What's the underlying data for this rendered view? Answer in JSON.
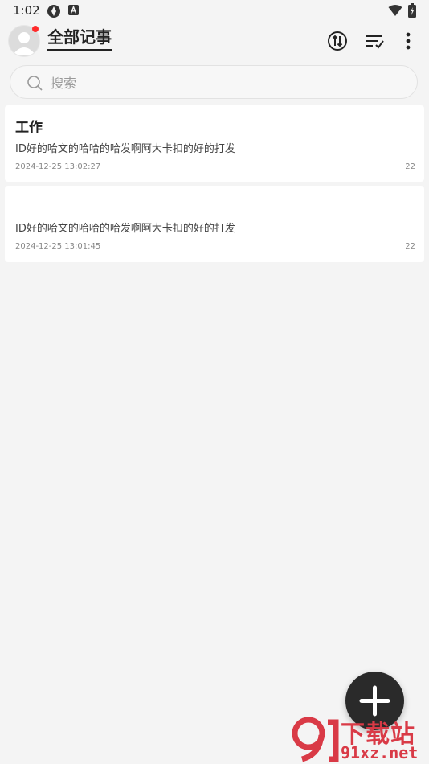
{
  "status_bar": {
    "time": "1:02",
    "icons": [
      "sync-status-icon",
      "a-badge-icon",
      "wifi-icon",
      "battery-icon"
    ]
  },
  "header": {
    "title": "全部记事",
    "avatar": "avatar-icon",
    "actions": [
      "sync-icon",
      "sort-icon",
      "more-vertical-icon"
    ],
    "notification_dot_color": "#ff2a2a"
  },
  "search": {
    "placeholder": "搜索",
    "value": ""
  },
  "notes": [
    {
      "title": "工作",
      "body": "ID好的哈文的哈哈的哈发啊阿大卡扣的好的打发",
      "date": "2024-12-25 13:02:27",
      "count": "22"
    },
    {
      "title": "",
      "body": "ID好的哈文的哈哈的哈发啊阿大卡扣的好的打发",
      "date": "2024-12-25 13:01:45",
      "count": "22"
    }
  ],
  "fab": {
    "icon": "plus-icon",
    "color": "#2a2a2a"
  },
  "watermark": {
    "text_top": "下载站",
    "text_bottom": "91xz.net",
    "color": "#d93a46"
  }
}
